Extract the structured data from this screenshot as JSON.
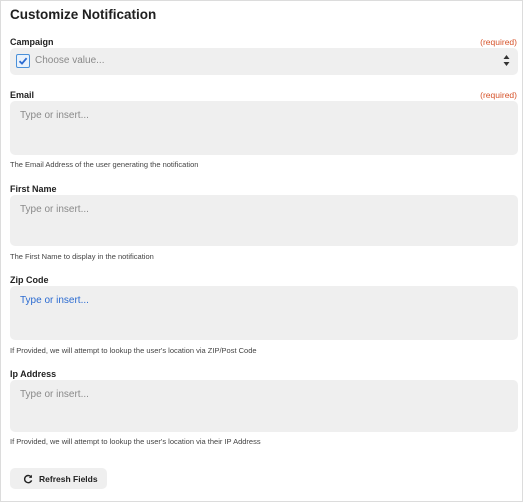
{
  "title": "Customize Notification",
  "campaign": {
    "label": "Campaign",
    "required": "(required)",
    "placeholder": "Choose value..."
  },
  "email": {
    "label": "Email",
    "required": "(required)",
    "placeholder": "Type or insert...",
    "help": "The Email Address of the user generating the notification"
  },
  "first_name": {
    "label": "First Name",
    "placeholder": "Type or insert...",
    "help": "The First Name to display in the notification"
  },
  "zip_code": {
    "label": "Zip Code",
    "placeholder": "Type or insert...",
    "help": "If Provided, we will attempt to lookup the user's location via ZIP/Post Code"
  },
  "ip_address": {
    "label": "Ip Address",
    "placeholder": "Type or insert...",
    "help": "If Provided, we will attempt to lookup the user's location via their IP Address"
  },
  "refresh_button": {
    "label": "Refresh Fields",
    "icon": "refresh-icon"
  },
  "colors": {
    "accent": "#2b6bd1",
    "required": "#d6532a",
    "field_bg": "#efefef",
    "checkbox_border": "#4a90d9"
  }
}
